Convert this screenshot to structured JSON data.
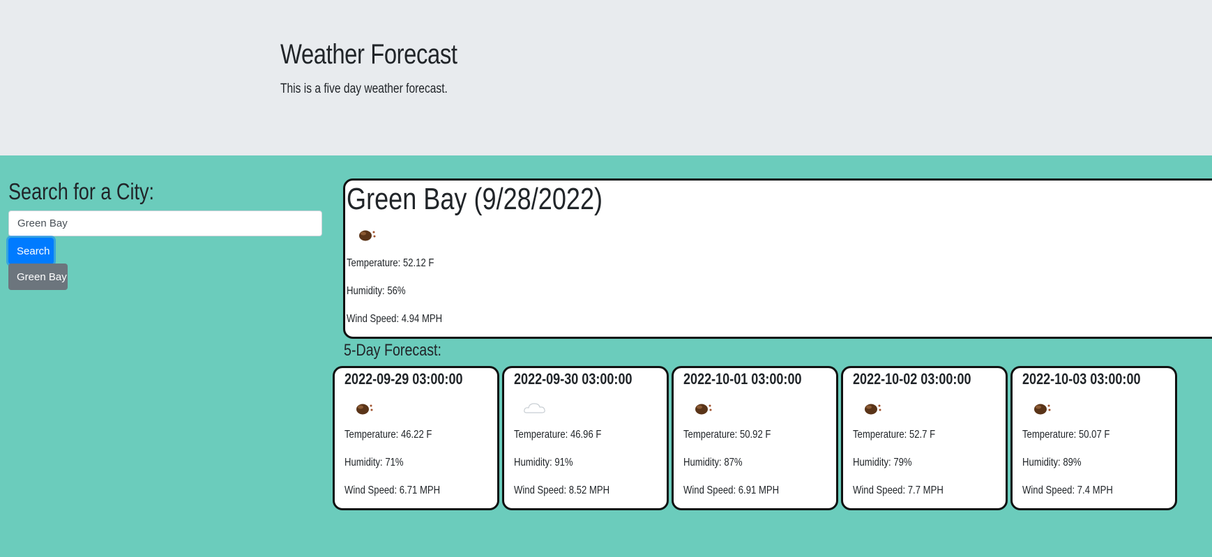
{
  "header": {
    "title": "Weather Forecast",
    "subtitle": "This is a five day weather forecast."
  },
  "search": {
    "heading": "Search for a City:",
    "input_value": "Green Bay",
    "button_label": "Search",
    "history": [
      "Green Bay"
    ]
  },
  "current": {
    "title": "Green Bay (9/28/2022)",
    "icon": "rain-icon",
    "temperature": "Temperature: 52.12 F",
    "humidity": "Humidity: 56%",
    "wind": "Wind Speed: 4.94 MPH"
  },
  "forecast": {
    "heading": "5-Day Forecast:",
    "days": [
      {
        "date": "2022-09-29 03:00:00",
        "icon": "rain-icon",
        "temperature": "Temperature: 46.22 F",
        "humidity": "Humidity: 71%",
        "wind": "Wind Speed: 6.71 MPH"
      },
      {
        "date": "2022-09-30 03:00:00",
        "icon": "cloud-icon",
        "temperature": "Temperature: 46.96 F",
        "humidity": "Humidity: 91%",
        "wind": "Wind Speed: 8.52 MPH"
      },
      {
        "date": "2022-10-01 03:00:00",
        "icon": "rain-icon",
        "temperature": "Temperature: 50.92 F",
        "humidity": "Humidity: 87%",
        "wind": "Wind Speed: 6.91 MPH"
      },
      {
        "date": "2022-10-02 03:00:00",
        "icon": "rain-icon",
        "temperature": "Temperature: 52.7 F",
        "humidity": "Humidity: 79%",
        "wind": "Wind Speed: 7.7 MPH"
      },
      {
        "date": "2022-10-03 03:00:00",
        "icon": "rain-icon",
        "temperature": "Temperature: 50.07 F",
        "humidity": "Humidity: 89%",
        "wind": "Wind Speed: 7.4 MPH"
      }
    ]
  },
  "colors": {
    "header_bg": "#e8ebee",
    "main_bg": "#6bccbc",
    "primary_button": "#007bff",
    "history_button": "#6c757d"
  }
}
